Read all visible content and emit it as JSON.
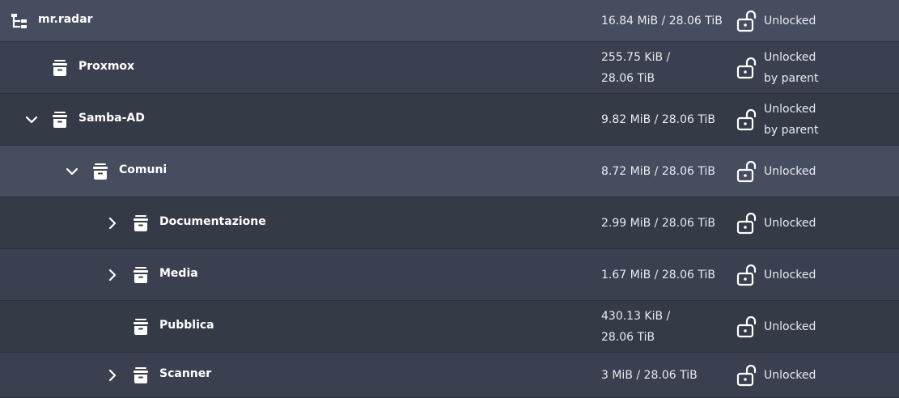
{
  "rows": [
    {
      "name": "mr.radar",
      "usage_line1": "16.84 MiB / 28.06 TiB",
      "usage_line2": "",
      "status_line1": "Unlocked",
      "status_line2": "",
      "toggle": "none",
      "icon": "tree-root-icon"
    },
    {
      "name": "Proxmox",
      "usage_line1": "255.75 KiB /",
      "usage_line2": "28.06 TiB",
      "status_line1": "Unlocked",
      "status_line2": "by parent",
      "toggle": "none",
      "icon": "dataset-icon"
    },
    {
      "name": "Samba-AD",
      "usage_line1": "9.82 MiB / 28.06 TiB",
      "usage_line2": "",
      "status_line1": "Unlocked",
      "status_line2": "by parent",
      "toggle": "expanded",
      "icon": "dataset-icon"
    },
    {
      "name": "Comuni",
      "usage_line1": "8.72 MiB / 28.06 TiB",
      "usage_line2": "",
      "status_line1": "Unlocked",
      "status_line2": "",
      "toggle": "expanded",
      "icon": "dataset-icon"
    },
    {
      "name": "Documentazione",
      "usage_line1": "2.99 MiB / 28.06 TiB",
      "usage_line2": "",
      "status_line1": "Unlocked",
      "status_line2": "",
      "toggle": "collapsed",
      "icon": "dataset-icon"
    },
    {
      "name": "Media",
      "usage_line1": "1.67 MiB / 28.06 TiB",
      "usage_line2": "",
      "status_line1": "Unlocked",
      "status_line2": "",
      "toggle": "collapsed",
      "icon": "dataset-icon"
    },
    {
      "name": "Pubblica",
      "usage_line1": "430.13 KiB /",
      "usage_line2": "28.06 TiB",
      "status_line1": "Unlocked",
      "status_line2": "",
      "toggle": "none",
      "icon": "dataset-icon"
    },
    {
      "name": "Scanner",
      "usage_line1": "3 MiB / 28.06 TiB",
      "usage_line2": "",
      "status_line1": "Unlocked",
      "status_line2": "",
      "toggle": "collapsed",
      "icon": "dataset-icon"
    }
  ],
  "colors": {
    "row_selected": "#464d5f",
    "row_dark": "#353a47",
    "row_mid": "#3b4050",
    "text": "#ffffff"
  }
}
